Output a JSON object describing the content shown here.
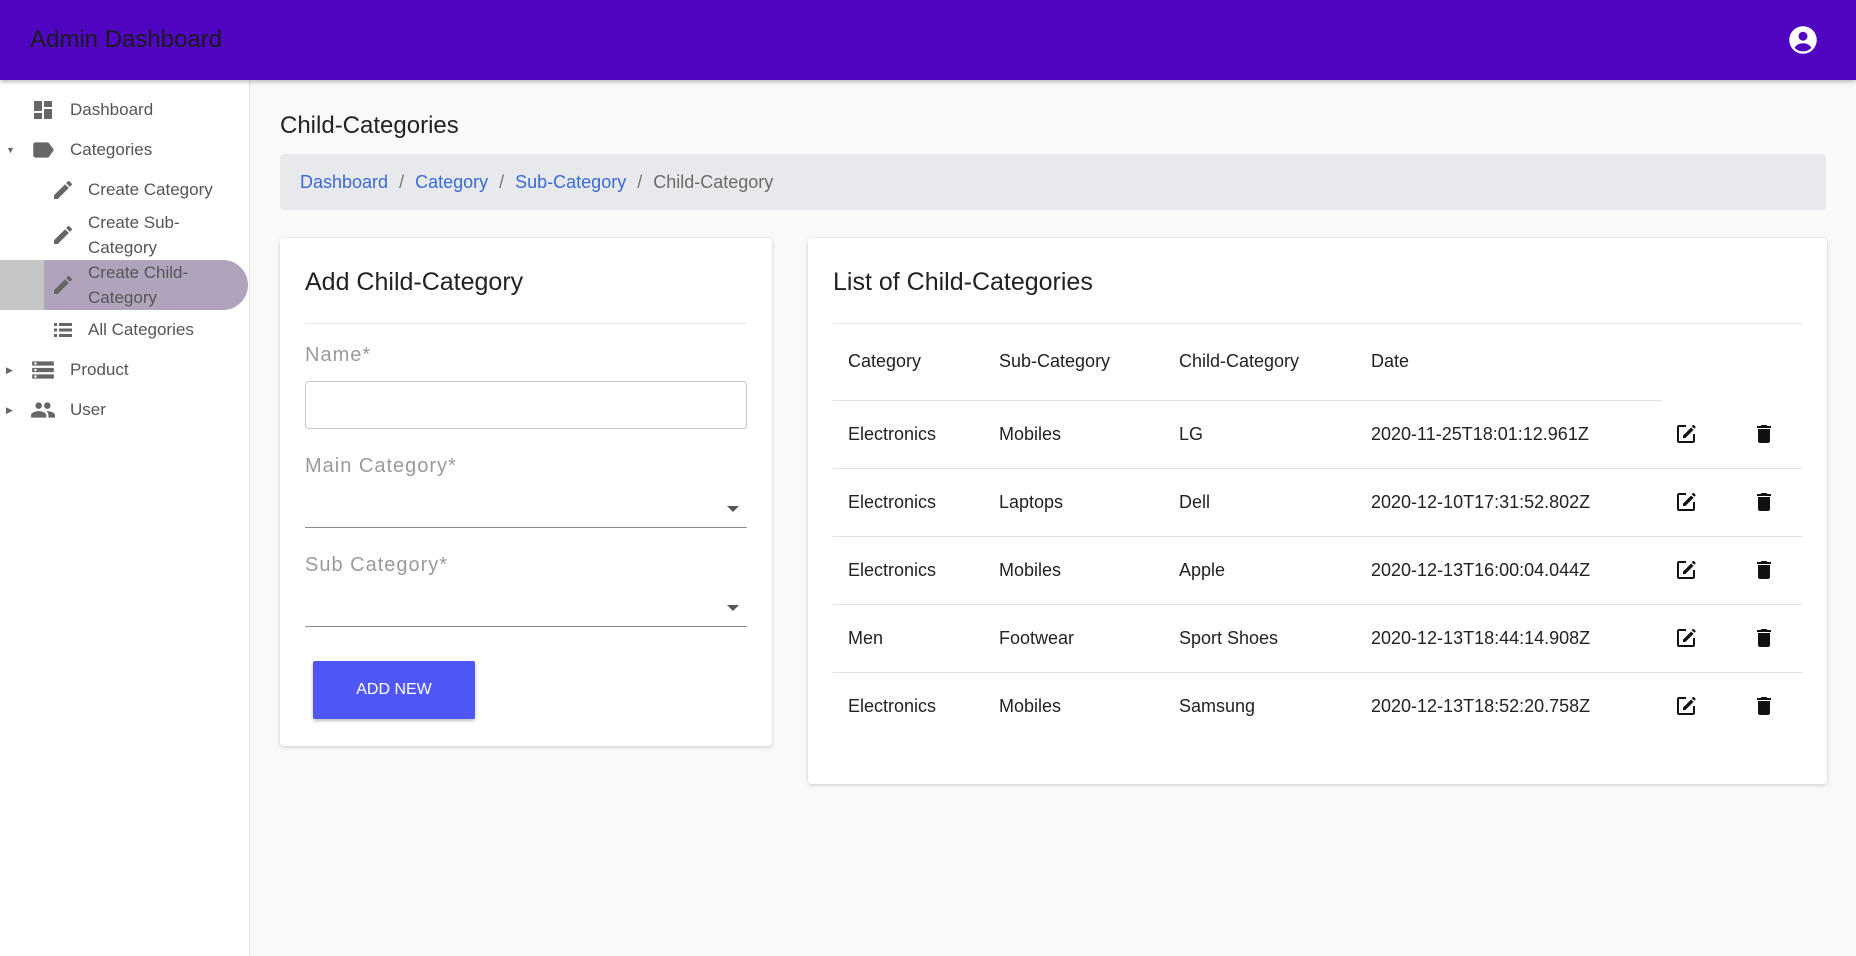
{
  "header": {
    "title": "Admin Dashboard",
    "account_icon": "account-circle-icon"
  },
  "sidebar": {
    "items": [
      {
        "label": "Dashboard",
        "icon": "dashboard-icon"
      },
      {
        "label": "Categories",
        "icon": "label-icon",
        "expanded": true
      },
      {
        "label": "Create Category",
        "icon": "pencil-icon"
      },
      {
        "label": "Create Sub-Category",
        "icon": "pencil-icon"
      },
      {
        "label": "Create Child-Category",
        "icon": "pencil-icon",
        "active": true
      },
      {
        "label": "All Categories",
        "icon": "list-icon"
      },
      {
        "label": "Product",
        "icon": "storage-icon"
      },
      {
        "label": "User",
        "icon": "people-icon"
      }
    ]
  },
  "page": {
    "title": "Child-Categories",
    "breadcrumb": [
      "Dashboard",
      "Category",
      "Sub-Category",
      "Child-Category"
    ]
  },
  "form": {
    "title": "Add Child-Category",
    "name_label": "Name*",
    "name_value": "",
    "main_category_label": "Main Category*",
    "main_category_value": "",
    "sub_category_label": "Sub Category*",
    "sub_category_value": "",
    "submit_label": "ADD NEW"
  },
  "list": {
    "title": "List of Child-Categories",
    "columns": [
      "Category",
      "Sub-Category",
      "Child-Category",
      "Date"
    ],
    "rows": [
      {
        "category": "Electronics",
        "sub": "Mobiles",
        "child": "LG",
        "date": "2020-11-25T18:01:12.961Z"
      },
      {
        "category": "Electronics",
        "sub": "Laptops",
        "child": "Dell",
        "date": "2020-12-10T17:31:52.802Z"
      },
      {
        "category": "Electronics",
        "sub": "Mobiles",
        "child": "Apple",
        "date": "2020-12-13T16:00:04.044Z"
      },
      {
        "category": "Men",
        "sub": "Footwear",
        "child": "Sport Shoes",
        "date": "2020-12-13T18:44:14.908Z"
      },
      {
        "category": "Electronics",
        "sub": "Mobiles",
        "child": "Samsung",
        "date": "2020-12-13T18:52:20.758Z"
      }
    ]
  },
  "colors": {
    "header": "#5006c0",
    "button": "#4f57f7",
    "active_nav": "#b0a4bd",
    "link": "#3a6ad6"
  }
}
